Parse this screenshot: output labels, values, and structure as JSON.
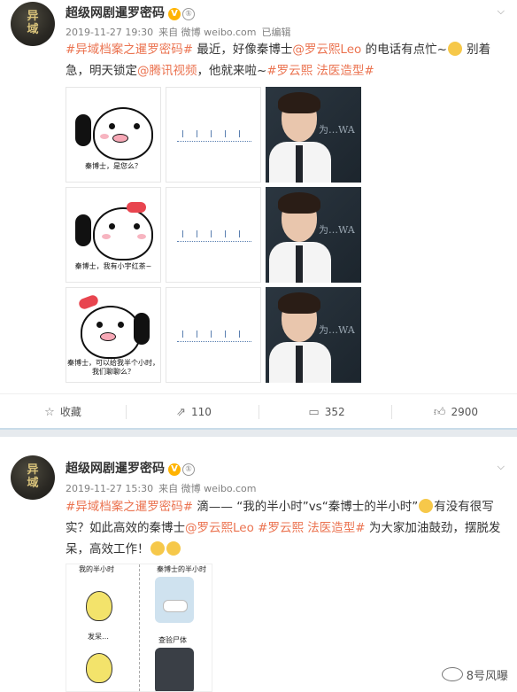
{
  "posts": [
    {
      "author": "超级网剧暹罗密码",
      "level_badge": "①",
      "time": "2019-11-27 19:30",
      "source": "来自 微博 weibo.com",
      "edited": "已编辑",
      "text": {
        "tag1": "#异域档案之暹罗密码#",
        "t1": " 最近，好像秦博士",
        "mention1": "@罗云熙Leo",
        "t2": " 的电话有点忙~",
        "t3": " 别着急，明天锁定",
        "mention2": "@腾讯视频",
        "t4": "，他就来啦~",
        "tag2": "#罗云熙 法医造型#"
      },
      "stickers": [
        {
          "caption": "秦博士，是您么？"
        },
        {
          "caption": "秦博士，我有小宇红茶~"
        },
        {
          "caption": "秦博士，可以给我半个小时，我们聊聊么？"
        }
      ],
      "photo_scribble": "为…WA",
      "actions": {
        "favorite_label": "收藏",
        "repost_count": "110",
        "comment_count": "352",
        "like_count": "2900"
      }
    },
    {
      "author": "超级网剧暹罗密码",
      "level_badge": "①",
      "time": "2019-11-27 15:30",
      "source": "来自 微博 weibo.com",
      "text": {
        "tag1": "#异域档案之暹罗密码#",
        "t1": " 滴—— “我的半小时”vs“秦博士的半小时”",
        "t2": "有没有很写实？如此高效的秦博士",
        "mention1": "@罗云熙Leo",
        "t3": " ",
        "tag2": "#罗云熙 法医造型#",
        "t4": " 为大家加油鼓劲，摆脱发呆，高效工作！"
      },
      "image_texts": {
        "left_top": "我的半小时",
        "right_top": "秦博士的半小时",
        "left_mid": "发呆…",
        "right_mid": "查验尸体"
      }
    }
  ],
  "watermark": "8号风曝",
  "colors": {
    "tag": "#eb7350",
    "verified": "#ffb300",
    "divider": "#e6eaee"
  }
}
